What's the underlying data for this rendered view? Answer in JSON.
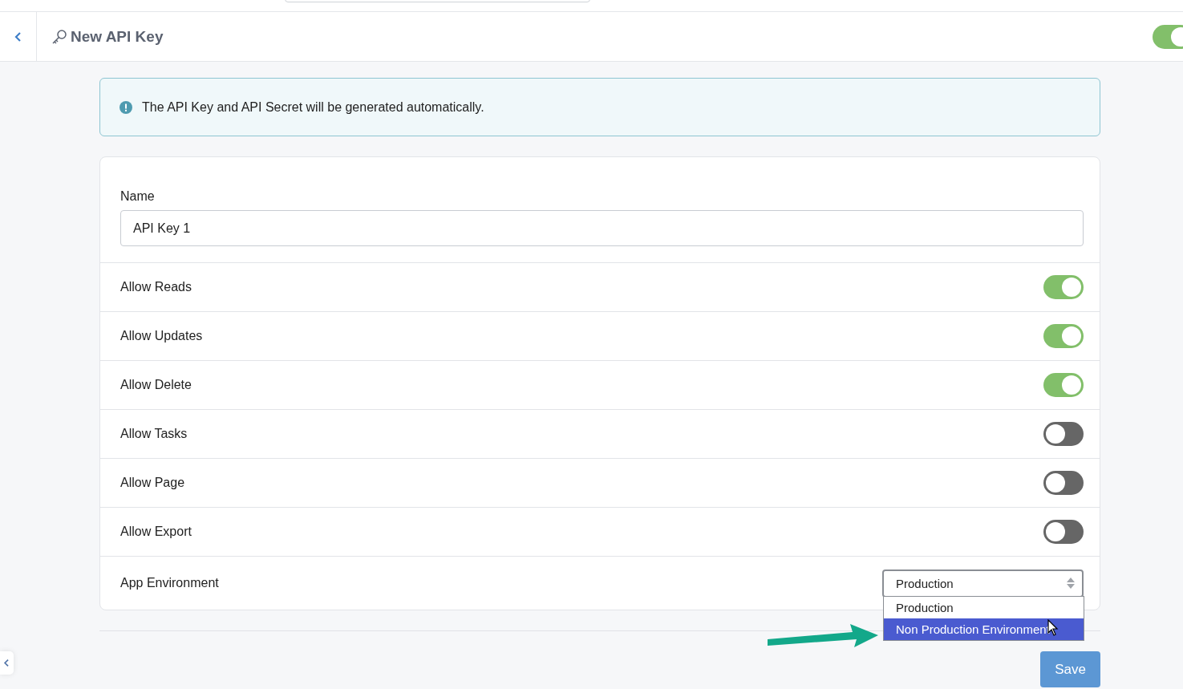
{
  "header": {
    "title": "New API Key",
    "toggle_on": true
  },
  "info": {
    "message": "The API Key and API Secret will be generated automatically."
  },
  "fields": [
    {
      "kind": "text",
      "label": "Name",
      "value": "API Key 1"
    },
    {
      "kind": "toggle",
      "label": "Allow Reads",
      "on": true
    },
    {
      "kind": "toggle",
      "label": "Allow Updates",
      "on": true
    },
    {
      "kind": "toggle",
      "label": "Allow Delete",
      "on": true
    },
    {
      "kind": "toggle",
      "label": "Allow Tasks",
      "on": false
    },
    {
      "kind": "toggle",
      "label": "Allow Page",
      "on": false
    },
    {
      "kind": "toggle",
      "label": "Allow Export",
      "on": false
    },
    {
      "kind": "select",
      "label": "App Environment",
      "value": "Production",
      "expanded": true,
      "options": [
        {
          "label": "Production",
          "highlighted": false
        },
        {
          "label": "Non Production Environment",
          "highlighted": true
        }
      ]
    }
  ],
  "save_button": "Save"
}
